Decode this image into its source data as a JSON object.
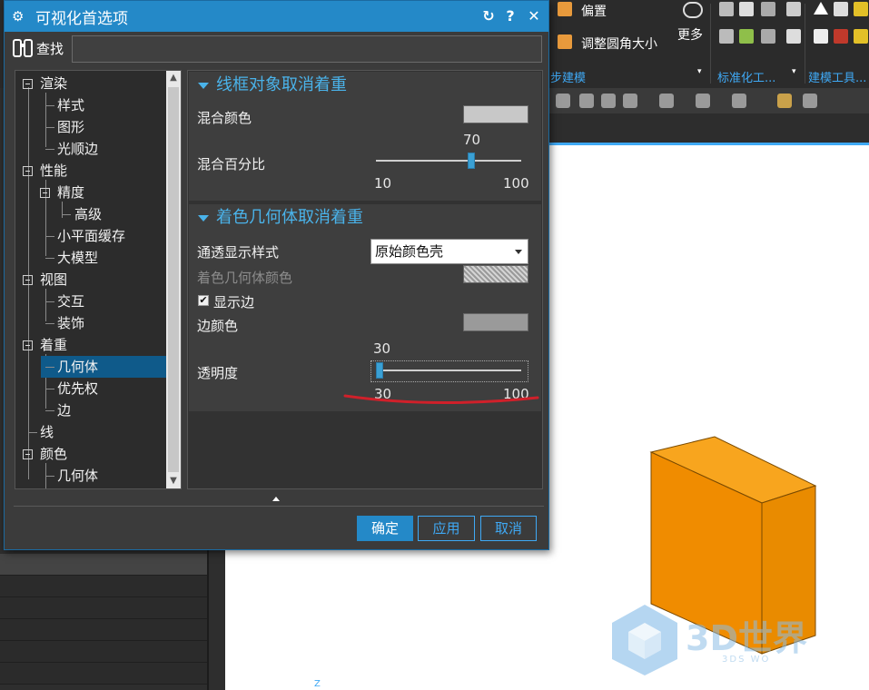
{
  "toolbar": {
    "offset_label": "偏置",
    "adjust_fillet_label": "调整圆角大小",
    "more_label": "更多",
    "group_sync": "步建模",
    "group_standard": "标准化工...",
    "group_modeling": "建模工具..."
  },
  "dialog": {
    "title": "可视化首选项",
    "reset_icon": "refresh-icon",
    "help_label": "?",
    "close_label": "✕"
  },
  "search": {
    "label": "查找",
    "value": "",
    "placeholder": ""
  },
  "tree": {
    "items": [
      {
        "label": "渲染"
      },
      {
        "label": "样式"
      },
      {
        "label": "图形"
      },
      {
        "label": "光顺边"
      },
      {
        "label": "性能"
      },
      {
        "label": "精度"
      },
      {
        "label": "高级"
      },
      {
        "label": "小平面缓存"
      },
      {
        "label": "大模型"
      },
      {
        "label": "视图"
      },
      {
        "label": "交互"
      },
      {
        "label": "装饰"
      },
      {
        "label": "着重"
      },
      {
        "label": "几何体"
      },
      {
        "label": "优先权"
      },
      {
        "label": "边"
      },
      {
        "label": "线"
      },
      {
        "label": "颜色"
      },
      {
        "label": "几何体"
      }
    ],
    "selected": "几何体"
  },
  "wireframe_section": {
    "title": "线框对象取消着重",
    "blend_color_label": "混合颜色",
    "blend_color": "#c8c8c8",
    "blend_percent_label": "混合百分比",
    "slider": {
      "value": "70",
      "min": "10",
      "max": "100",
      "fraction": 0.667
    }
  },
  "shaded_section": {
    "title": "着色几何体取消着重",
    "transparent_style_label": "通透显示样式",
    "transparent_style_value": "原始颜色壳",
    "shaded_color_label": "着色几何体颜色",
    "show_edges_label": "显示边",
    "show_edges_checked": "✔",
    "edge_color_label": "边颜色",
    "edge_color": "#9a9a9a",
    "transparency_label": "透明度",
    "slider": {
      "value": "30",
      "min": "30",
      "max": "100",
      "fraction": 0.0
    }
  },
  "buttons": {
    "ok": "确定",
    "apply": "应用",
    "cancel": "取消"
  },
  "viewport": {
    "axis_label": "Z",
    "watermark": "3D世界",
    "watermark_sub": "3DS WO",
    "box_front_color": "#f08c00",
    "box_top_color": "#f8a51e",
    "box_side_color": "#e07e00"
  },
  "colors": {
    "accent": "#2489c8",
    "section_header": "#4ab3ea",
    "annotation_red": "#d0202a"
  }
}
